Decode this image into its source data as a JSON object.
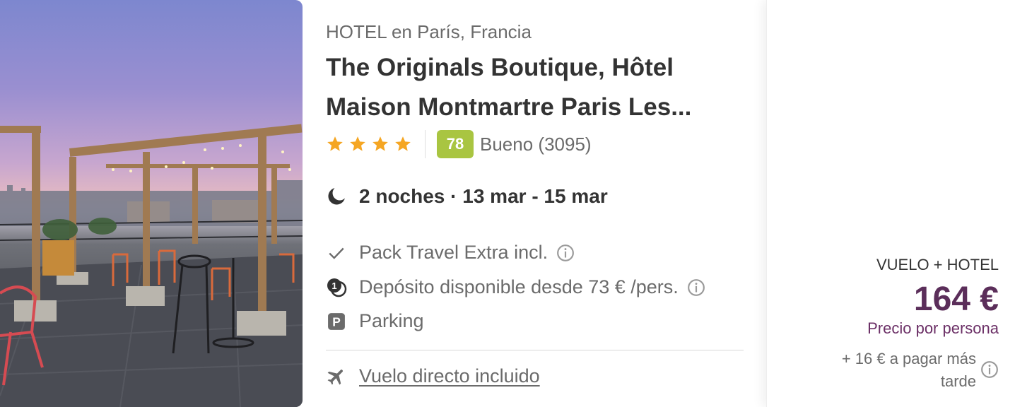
{
  "hotel": {
    "location": "HOTEL en París, Francia",
    "name_line1": "The Originals Boutique, Hôtel",
    "name_line2": "Maison Montmartre Paris Les...",
    "stars": 4,
    "score": "78",
    "score_text": "Bueno (3095)",
    "stay": "2 noches · 13 mar - 15 mar"
  },
  "features": {
    "pack": "Pack Travel Extra incl.",
    "deposit": "Depósito disponible desde 73 € /pers.",
    "parking": "Parking"
  },
  "flight": {
    "label": "Vuelo directo incluido"
  },
  "price": {
    "package": "VUELO + HOTEL",
    "amount": "164 €",
    "per": "Precio por persona",
    "later": "+ 16 € a pagar más tarde"
  },
  "colors": {
    "star": "#f5a623",
    "score_badge": "#a9c541",
    "price": "#5b2e5a"
  },
  "icons": [
    "moon-icon",
    "check-icon",
    "deposit-icon",
    "parking-icon",
    "plane-icon",
    "info-icon",
    "star-icon"
  ]
}
